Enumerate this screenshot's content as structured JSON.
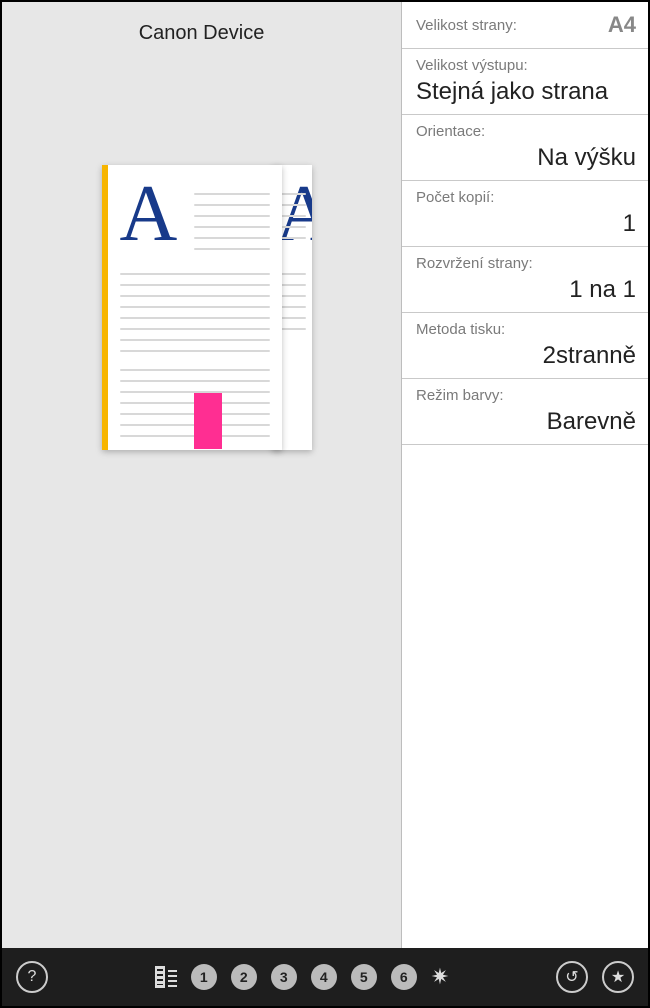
{
  "header": {
    "device_name": "Canon Device"
  },
  "settings": {
    "page_size": {
      "label": "Velikost strany:",
      "value": "A4"
    },
    "output_size": {
      "label": "Velikost výstupu:",
      "value": "Stejná jako strana"
    },
    "orientation": {
      "label": "Orientace:",
      "value": "Na výšku"
    },
    "copies": {
      "label": "Počet kopií:",
      "value": "1"
    },
    "layout": {
      "label": "Rozvržení strany:",
      "value": "1 na 1"
    },
    "print_method": {
      "label": "Metoda tisku:",
      "value": "2stranně"
    },
    "color_mode": {
      "label": "Režim barvy:",
      "value": "Barevně"
    }
  },
  "bottom_bar": {
    "help": "?",
    "presets": [
      "1",
      "2",
      "3",
      "4",
      "5",
      "6"
    ],
    "settings_icon": "✷",
    "undo_icon": "↺",
    "star_icon": "★"
  }
}
